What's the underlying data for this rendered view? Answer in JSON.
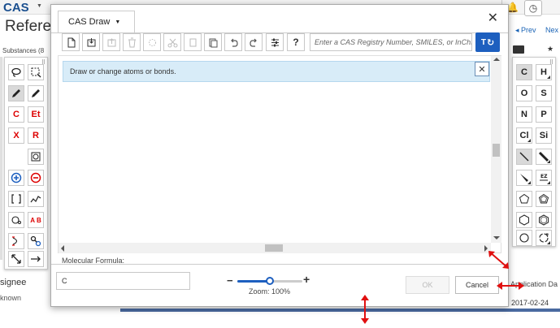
{
  "background": {
    "logo": "CAS",
    "page_title": "Refere",
    "substances_label": "Substances (8",
    "prev_label": "◂ Prev",
    "next_label": "Nex",
    "assignee_label": "signee",
    "unknown_label": "known",
    "application_date_label": "Application Da",
    "application_date_value": "2017-02-24"
  },
  "dialog": {
    "title": "CAS Draw",
    "close_symbol": "✕",
    "toolbar": {
      "help_label": "?",
      "lookup_placeholder": "Enter a CAS Registry Number, SMILES, or InChI...",
      "lookup_button_label": "T"
    },
    "info_message": "Draw or change atoms or bonds.",
    "info_close_symbol": "✕",
    "molecular_formula_label": "Molecular Formula:",
    "molecular_formula_value": "C",
    "zoom": {
      "minus": "−",
      "plus": "+",
      "label": "Zoom: 100%",
      "slider_fraction": 0.5
    },
    "ok_label": "OK",
    "cancel_label": "Cancel"
  },
  "left_palette": {
    "carbon_label": "C",
    "ethyl_label": "Et",
    "halogen_label": "X",
    "rgroup_label": "R",
    "plus_charge": "+",
    "minus_charge": "−",
    "attach_label": "A B"
  },
  "right_palette": {
    "atoms": [
      "C",
      "H",
      "O",
      "S",
      "N",
      "P",
      "Cl",
      "Si"
    ]
  },
  "colors": {
    "accent": "#1d5fbf",
    "info_background": "#d8ecf8",
    "resize_arrow": "#e01010",
    "atom_red": "#dd0000"
  }
}
